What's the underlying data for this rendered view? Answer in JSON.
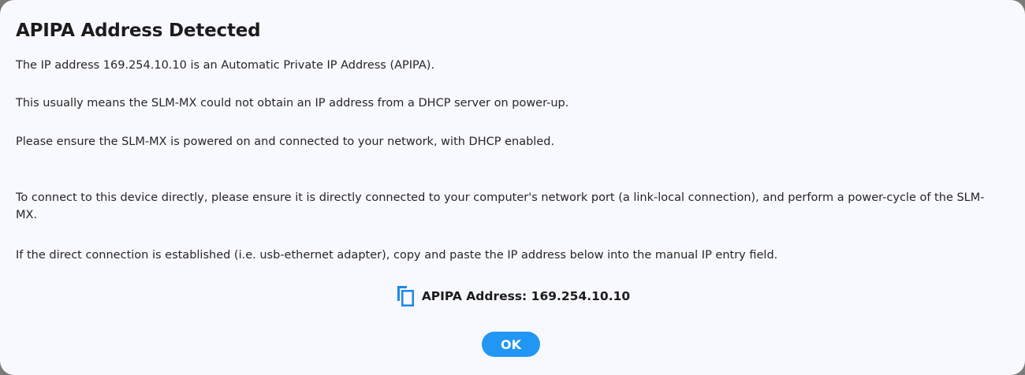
{
  "dialog": {
    "title": "APIPA Address Detected",
    "paragraphs": {
      "p1": "The IP address 169.254.10.10 is an Automatic Private IP Address (APIPA).",
      "p2": "This usually means the SLM-MX could not obtain an IP address from a DHCP server on power-up.",
      "p3": "Please ensure the SLM-MX is powered on and connected to your network, with DHCP enabled.",
      "p4": "To connect to this device directly, please ensure it is directly connected to your computer's network port (a link-local connection), and perform a power-cycle of the SLM-MX.",
      "p5": "If the direct connection is established (i.e. usb-ethernet adapter), copy and paste the IP address below into the manual IP entry field."
    },
    "address": {
      "icon": "copy-icon",
      "label": "APIPA Address: 169.254.10.10"
    },
    "ok_label": "OK",
    "colors": {
      "accent": "#2196f3",
      "background": "#f8f9ff"
    }
  }
}
